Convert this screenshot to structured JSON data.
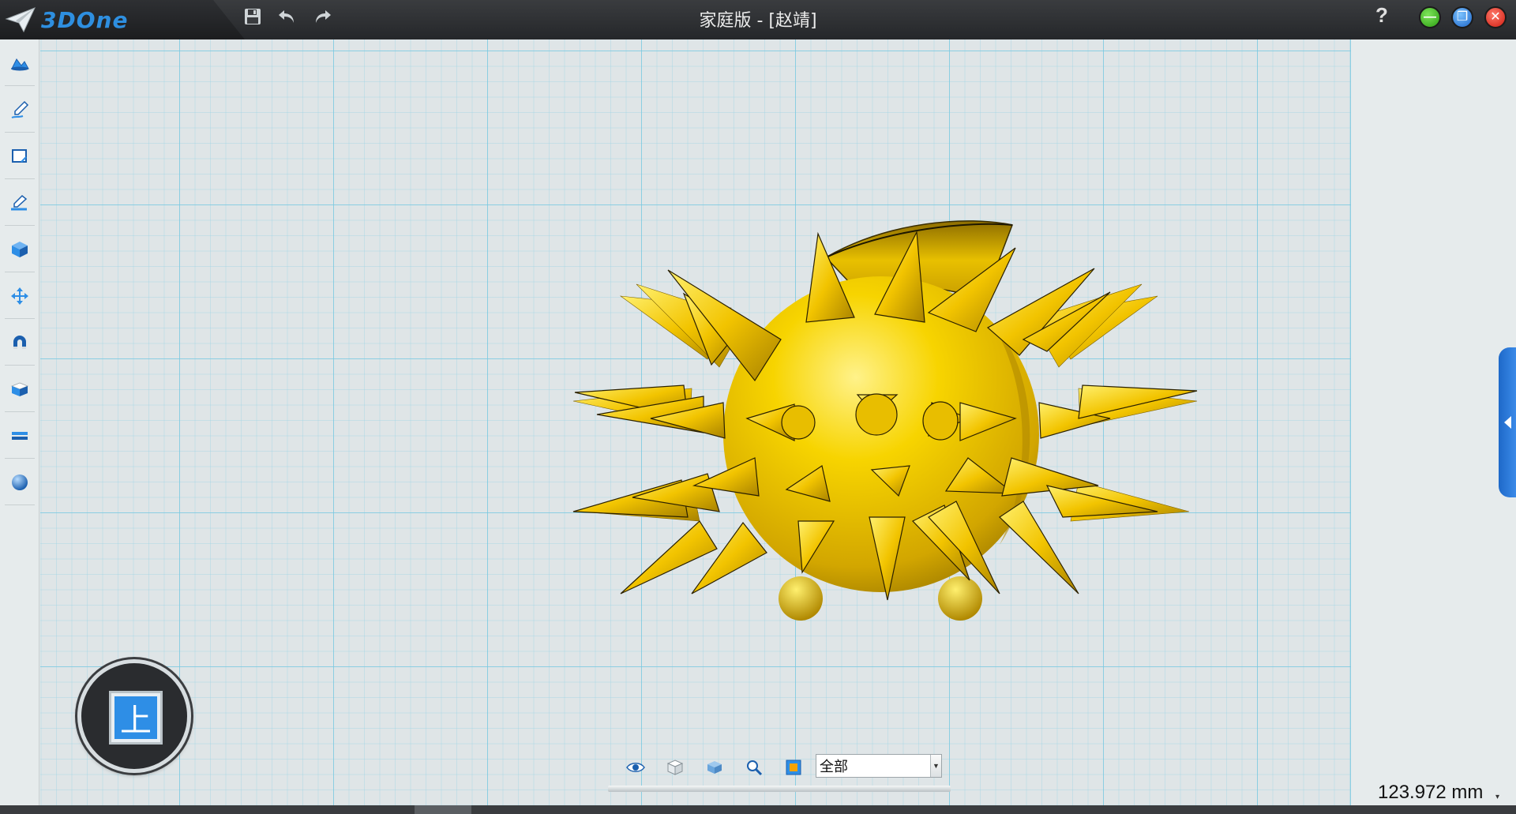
{
  "app": {
    "name": "3DOne",
    "window_title": "家庭版 - [赵靖]",
    "help_label": "?"
  },
  "quick_tools": [
    "save-icon",
    "undo-icon",
    "redo-icon"
  ],
  "window_controls": {
    "minimize": "—",
    "restore": "❐",
    "close": "✕",
    "colors": {
      "minimize": "#3fb81f",
      "restore": "#2a7ee0",
      "close": "#e0291b"
    }
  },
  "left_toolbar": [
    "basic-solid-icon",
    "sketch-pen-icon",
    "sketch-rectangle-icon",
    "sketch-edit-icon",
    "special-feature-cube-icon",
    "move-arrows-icon",
    "magnet-snap-icon",
    "combine-cube-icon",
    "measure-ruler-icon",
    "sphere-material-icon"
  ],
  "view_cube": {
    "face_label": "上"
  },
  "bottom_toolbar": {
    "tools": [
      "eye-visibility-icon",
      "wireframe-cube-icon",
      "shaded-cube-icon",
      "zoom-magnifier-icon",
      "render-view-icon"
    ],
    "filter": {
      "selected": "全部"
    }
  },
  "status": {
    "measurement": "123.972 mm"
  },
  "colors": {
    "model_gold": "#f2c400",
    "accent_blue": "#2e8ee6",
    "grid_line": "#78c8e1",
    "background": "#dfe5e7"
  }
}
